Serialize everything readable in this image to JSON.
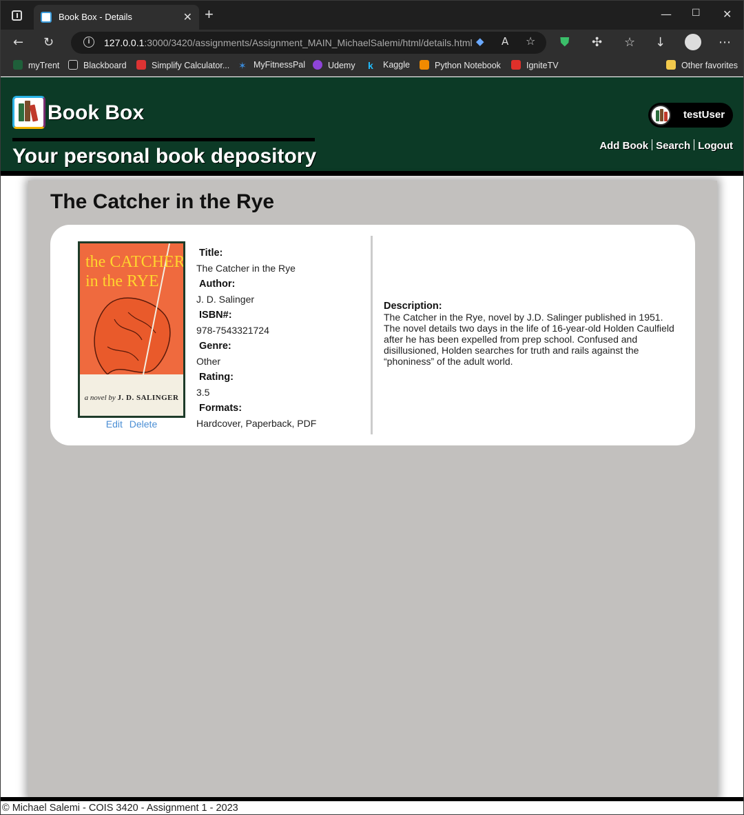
{
  "browser": {
    "tab_title": "Book Box - Details",
    "url_host": "127.0.0.1",
    "url_rest": ":3000/3420/assignments/Assignment_MAIN_MichaelSalemi/html/details.html",
    "bookmarks": [
      "myTrent",
      "Blackboard",
      "Simplify Calculator...",
      "MyFitnessPal",
      "Udemy",
      "Kaggle",
      "Python Notebook",
      "IgniteTV",
      "Other favorites"
    ]
  },
  "header": {
    "site_title": "Book Box",
    "tagline": "Your personal book depository",
    "username": "testUser",
    "nav": [
      "Add Book",
      "Search",
      "Logout"
    ]
  },
  "book": {
    "heading": "The Catcher in the Rye",
    "cover_title_line1": "the CATCHER",
    "cover_title_line2": "in the RYE",
    "cover_author_prefix": "a novel by",
    "cover_author_name": "J. D. SALINGER",
    "actions": {
      "edit": "Edit",
      "delete": "Delete"
    },
    "fields": [
      {
        "label": "Title:",
        "value": "The Catcher in the Rye"
      },
      {
        "label": "Author:",
        "value": "J. D. Salinger"
      },
      {
        "label": "ISBN#:",
        "value": "978-7543321724"
      },
      {
        "label": "Genre:",
        "value": "Other"
      },
      {
        "label": "Rating:",
        "value": "3.5"
      },
      {
        "label": "Formats:",
        "value": "Hardcover, Paperback, PDF"
      }
    ],
    "description_label": "Description:",
    "description": "The Catcher in the Rye, novel by J.D. Salinger published in 1951. The novel details two days in the life of 16-year-old Holden Caulfield after he has been expelled from prep school. Confused and disillusioned, Holden searches for truth and rails against the “phoniness” of the adult world."
  },
  "footer": {
    "text": "© Michael Salemi - COIS 3420 - Assignment 1 - 2023"
  }
}
